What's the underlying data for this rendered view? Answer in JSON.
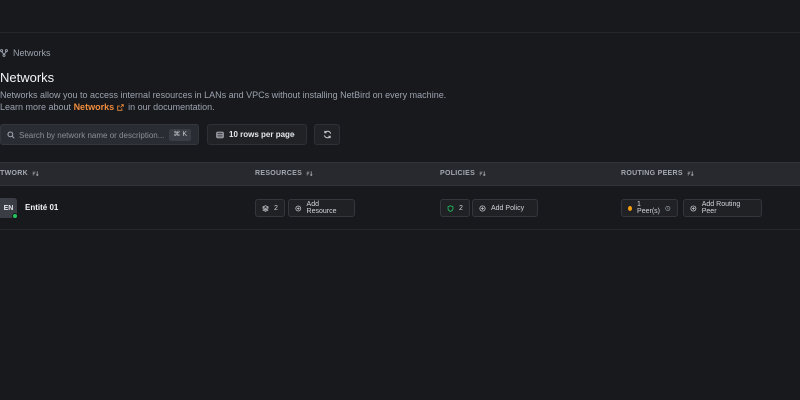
{
  "breadcrumb": {
    "label": "Networks"
  },
  "page": {
    "title": "Networks",
    "description_line1": "Networks allow you to access internal resources in LANs and VPCs without installing NetBird on every machine.",
    "learn_more_prefix": "Learn more about",
    "learn_more_link": "Networks",
    "learn_more_suffix": "in our documentation."
  },
  "toolbar": {
    "search_placeholder": "Search by network name or description...",
    "search_shortcut": "⌘ K",
    "rows_count": "10",
    "rows_label": "rows per page"
  },
  "table": {
    "headers": [
      "TWORK",
      "RESOURCES",
      "POLICIES",
      "ROUTING PEERS"
    ],
    "rows": [
      {
        "initials": "EN",
        "name": "Entité 01",
        "resources_count": "2",
        "add_resource_label": "Add Resource",
        "policies_count": "2",
        "add_policy_label": "Add Policy",
        "peers_label": "1 Peer(s)",
        "add_peer_label": "Add Routing Peer"
      }
    ]
  },
  "colors": {
    "background": "#18191d",
    "accent_link": "#f08c3a",
    "status_online": "#22c55e",
    "peer_dot": "#f59e0b",
    "policy_icon": "#22c55e"
  },
  "icons": [
    "network-icon",
    "external-link-icon",
    "search-icon",
    "table-icon",
    "chevron-down-icon",
    "refresh-icon",
    "sort-icon",
    "layers-icon",
    "plus-circle-icon",
    "shield-icon",
    "help-circle-icon"
  ]
}
